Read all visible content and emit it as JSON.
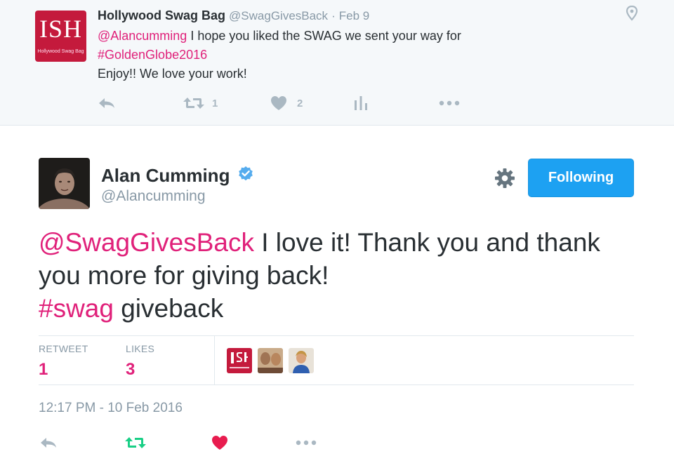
{
  "parent_tweet": {
    "avatar_logo": "ISH",
    "avatar_caption": "Hollywood Swag Bag",
    "name": "Hollywood Swag Bag",
    "handle": "@SwagGivesBack",
    "separator": "·",
    "date": "Feb 9",
    "mention": "@Alancumming",
    "text_1": " I hope you liked the SWAG we sent your way for",
    "hashtag": "#GoldenGlobe2016",
    "text_2": "Enjoy!!  We love your work!",
    "retweet_count": "1",
    "like_count": "2"
  },
  "main_tweet": {
    "name": "Alan Cumming",
    "handle": "@Alancumming",
    "follow_button": "Following",
    "mention": "@SwagGivesBack",
    "text_1": " I love it! Thank you and thank you more for giving back!",
    "hashtag": "#swag",
    "text_2": " giveback",
    "retweets_label": "RETWEET",
    "retweets_value": "1",
    "likes_label": "LIKES",
    "likes_value": "3",
    "timestamp": "12:17 PM - 10 Feb 2016"
  },
  "colors": {
    "accent_link": "#e0217a",
    "follow_button": "#1da1f2",
    "retweeted_green": "#19cf86",
    "liked_red": "#e81c4f",
    "muted": "#8899a6"
  },
  "icons": [
    "location-pin-icon",
    "reply-icon",
    "retweet-icon",
    "heart-icon",
    "analytics-icon",
    "more-icon",
    "verified-badge-icon",
    "gear-icon"
  ]
}
